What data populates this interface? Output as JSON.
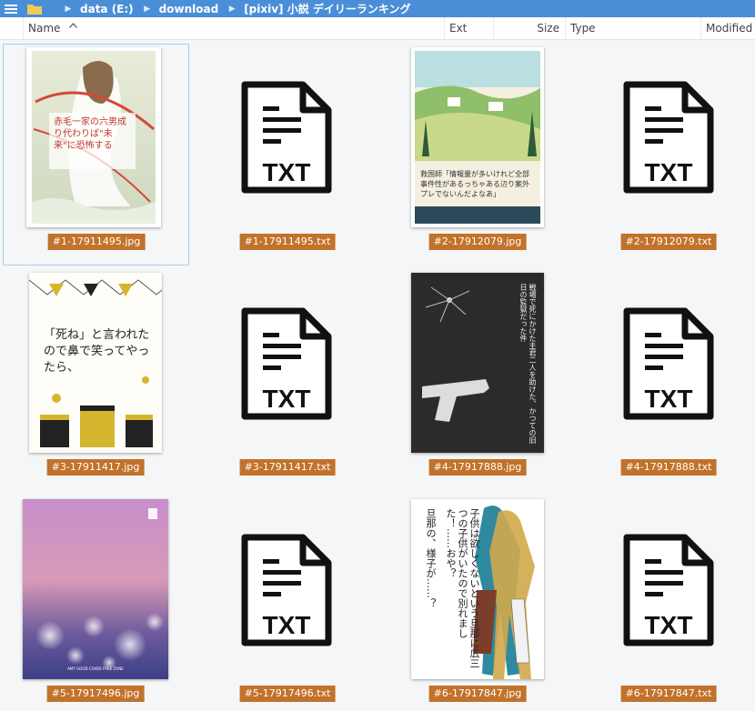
{
  "breadcrumb": [
    "data (E:)",
    "download",
    "[pixiv] 小説 デイリーランキング"
  ],
  "columns": {
    "name": "Name",
    "ext": "Ext",
    "size": "Size",
    "type": "Type",
    "modified": "Modified"
  },
  "files": [
    {
      "name": "#1-17911495.jpg",
      "kind": "image"
    },
    {
      "name": "#1-17911495.txt",
      "kind": "txt"
    },
    {
      "name": "#2-17912079.jpg",
      "kind": "image"
    },
    {
      "name": "#2-17912079.txt",
      "kind": "txt"
    },
    {
      "name": "#3-17911417.jpg",
      "kind": "image"
    },
    {
      "name": "#3-17911417.txt",
      "kind": "txt"
    },
    {
      "name": "#4-17917888.jpg",
      "kind": "image"
    },
    {
      "name": "#4-17917888.txt",
      "kind": "txt"
    },
    {
      "name": "#5-17917496.jpg",
      "kind": "image"
    },
    {
      "name": "#5-17917496.txt",
      "kind": "txt"
    },
    {
      "name": "#6-17917847.jpg",
      "kind": "image"
    },
    {
      "name": "#6-17917847.txt",
      "kind": "txt"
    }
  ],
  "covers": {
    "c1": "赤毛一家の六男成り代わりば\"未来\"に恐怖する",
    "c2": "救国師「情報量が多いけれど全部事件性があるっちゃある辺り案外プレでないんだよなあ」",
    "c3": "「死ね」と言われたので鼻で笑ってやったら、",
    "c4": "戦場で死にかけた主君二人を助けた、かつての旧日の監獄だった件",
    "c5": "AMY GOOD COVER FREE ZONE",
    "c6a": "子供は欲しくないという旦那に広三つの子供がいたので別れました！……おや？",
    "c6b": "旦那の、様子が……？"
  },
  "txt_icon_label": "TXT"
}
